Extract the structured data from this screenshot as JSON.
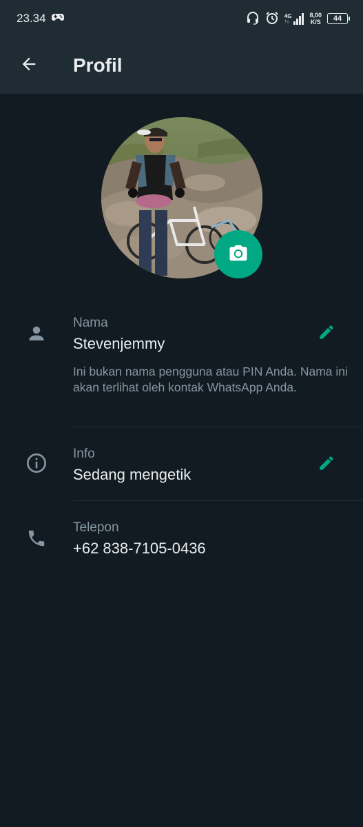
{
  "status_bar": {
    "time": "23.34",
    "network_type": "4G",
    "net_speed_value": "8,00",
    "net_speed_unit": "K/S",
    "battery_level": "44",
    "icons": [
      "gamepad-icon",
      "headset-icon",
      "alarm-icon",
      "signal-icon",
      "battery-icon"
    ]
  },
  "toolbar": {
    "title": "Profil"
  },
  "profile": {
    "name_label": "Nama",
    "name_value": "Stevenjemmy",
    "name_note": "Ini bukan nama pengguna atau PIN Anda. Nama ini akan terlihat oleh kontak WhatsApp Anda.",
    "info_label": "Info",
    "info_value": "Sedang mengetik",
    "phone_label": "Telepon",
    "phone_value": "+62 838-7105-0436"
  },
  "colors": {
    "background": "#121b22",
    "header": "#1f2c34",
    "accent": "#00a884",
    "text_primary": "#e9edef",
    "text_secondary": "#8696a0"
  }
}
